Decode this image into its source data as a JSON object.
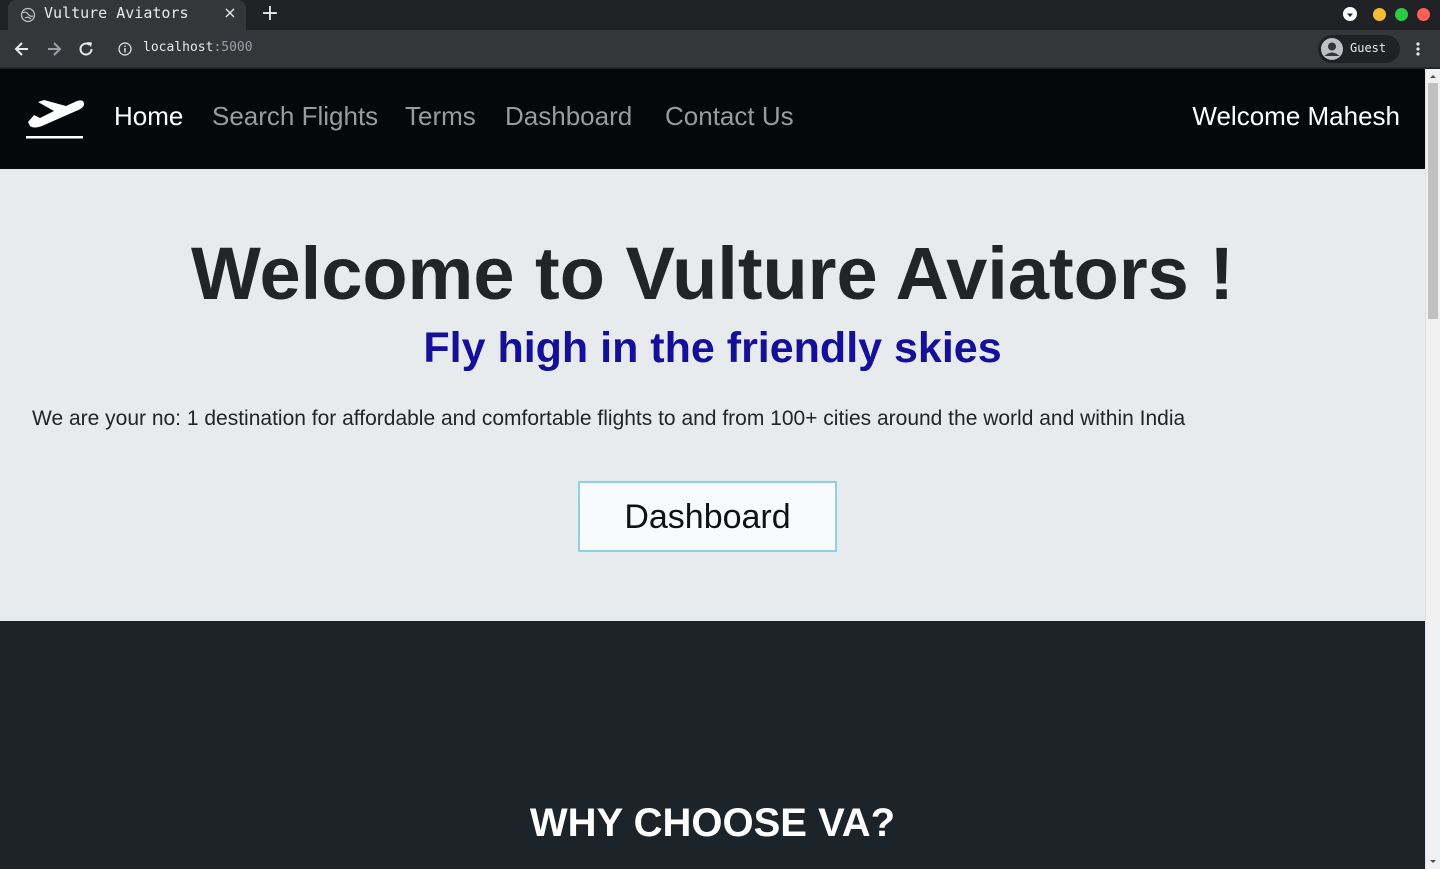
{
  "browser": {
    "tab_title": "Vulture Aviators",
    "tab_close": "×",
    "new_tab": "+",
    "url_host": "localhost",
    "url_port": ":5000",
    "profile_label": "Guest",
    "window_buttons": {
      "minimize": "#f5bc2f",
      "maximize": "#2aca44",
      "close": "#fe5f57"
    }
  },
  "nav": {
    "logo_icon": "airplane-takeoff-icon",
    "links": [
      {
        "label": "Home",
        "active": true
      },
      {
        "label": "Search Flights",
        "active": false
      },
      {
        "label": "Terms",
        "active": false
      },
      {
        "label": "Dashboard",
        "active": false
      },
      {
        "label": "Contact Us",
        "active": false
      }
    ],
    "welcome": "Welcome Mahesh"
  },
  "hero": {
    "title": "Welcome to Vulture Aviators !",
    "subtitle": "Fly high in the friendly skies",
    "description": "We are your no: 1 destination for affordable and comfortable flights to and from 100+ cities around the world and within India",
    "button_label": "Dashboard"
  },
  "why_section": {
    "title": "WHY CHOOSE VA?"
  },
  "colors": {
    "nav_bg": "#060709",
    "hero_bg": "#e8ebee",
    "subtitle": "#14109a",
    "section_dark": "#1c2329",
    "button_border": "#8fd1df"
  }
}
